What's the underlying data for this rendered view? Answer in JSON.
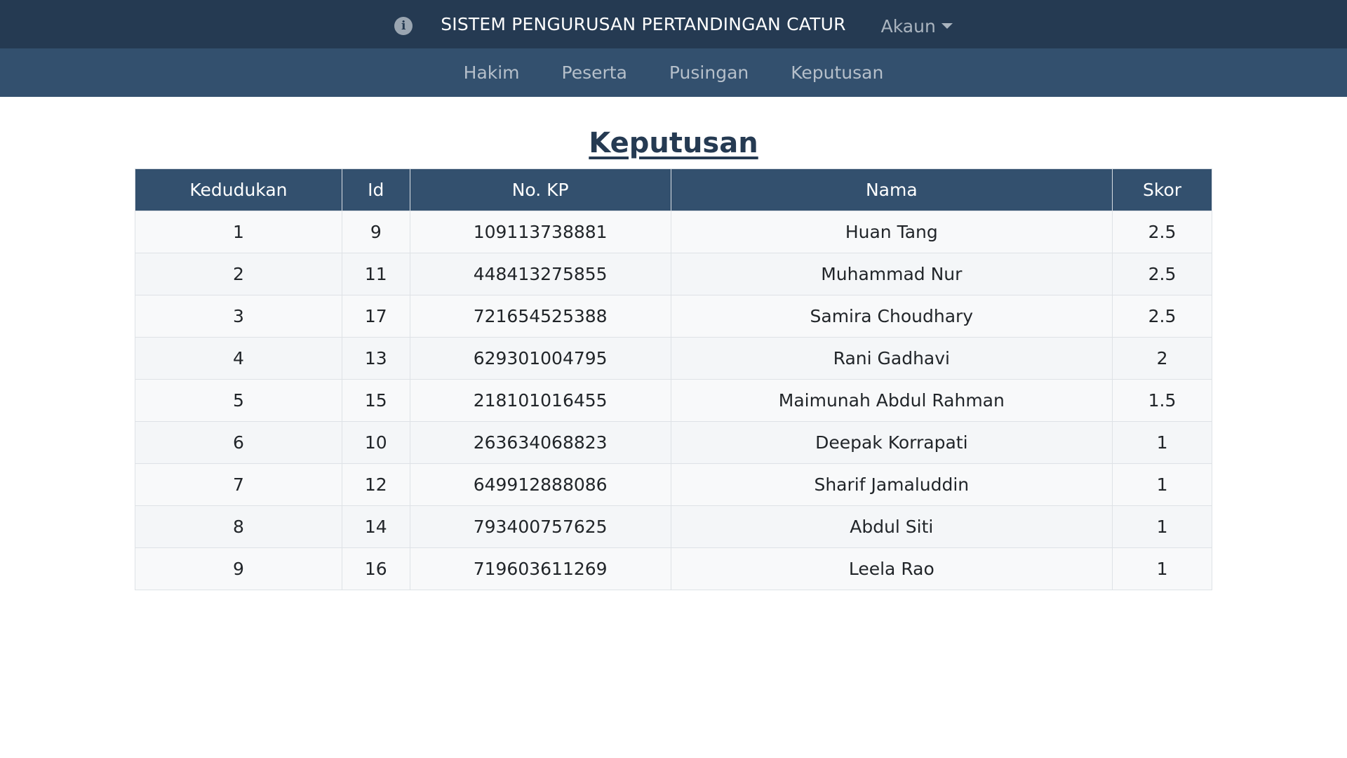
{
  "header": {
    "info_icon": "info-circle-icon",
    "title": "SISTEM PENGURUSAN PERTANDINGAN CATUR",
    "account_label": "Akaun"
  },
  "nav": {
    "items": [
      {
        "label": "Hakim"
      },
      {
        "label": "Peserta"
      },
      {
        "label": "Pusingan"
      },
      {
        "label": "Keputusan"
      }
    ]
  },
  "page": {
    "title": "Keputusan"
  },
  "table": {
    "headers": {
      "rank": "Kedudukan",
      "id": "Id",
      "kp": "No. KP",
      "name": "Nama",
      "score": "Skor"
    },
    "rows": [
      {
        "rank": "1",
        "id": "9",
        "kp": "109113738881",
        "name": "Huan Tang",
        "score": "2.5"
      },
      {
        "rank": "2",
        "id": "11",
        "kp": "448413275855",
        "name": "Muhammad Nur",
        "score": "2.5"
      },
      {
        "rank": "3",
        "id": "17",
        "kp": "721654525388",
        "name": "Samira Choudhary",
        "score": "2.5"
      },
      {
        "rank": "4",
        "id": "13",
        "kp": "629301004795",
        "name": "Rani Gadhavi",
        "score": "2"
      },
      {
        "rank": "5",
        "id": "15",
        "kp": "218101016455",
        "name": "Maimunah Abdul Rahman",
        "score": "1.5"
      },
      {
        "rank": "6",
        "id": "10",
        "kp": "263634068823",
        "name": "Deepak Korrapati",
        "score": "1"
      },
      {
        "rank": "7",
        "id": "12",
        "kp": "649912888086",
        "name": "Sharif Jamaluddin",
        "score": "1"
      },
      {
        "rank": "8",
        "id": "14",
        "kp": "793400757625",
        "name": "Abdul Siti",
        "score": "1"
      },
      {
        "rank": "9",
        "id": "16",
        "kp": "719603611269",
        "name": "Leela Rao",
        "score": "1"
      }
    ]
  },
  "colors": {
    "topbar": "#253a52",
    "navbar": "#33506e",
    "table_header": "#33506e",
    "title": "#253a52"
  }
}
